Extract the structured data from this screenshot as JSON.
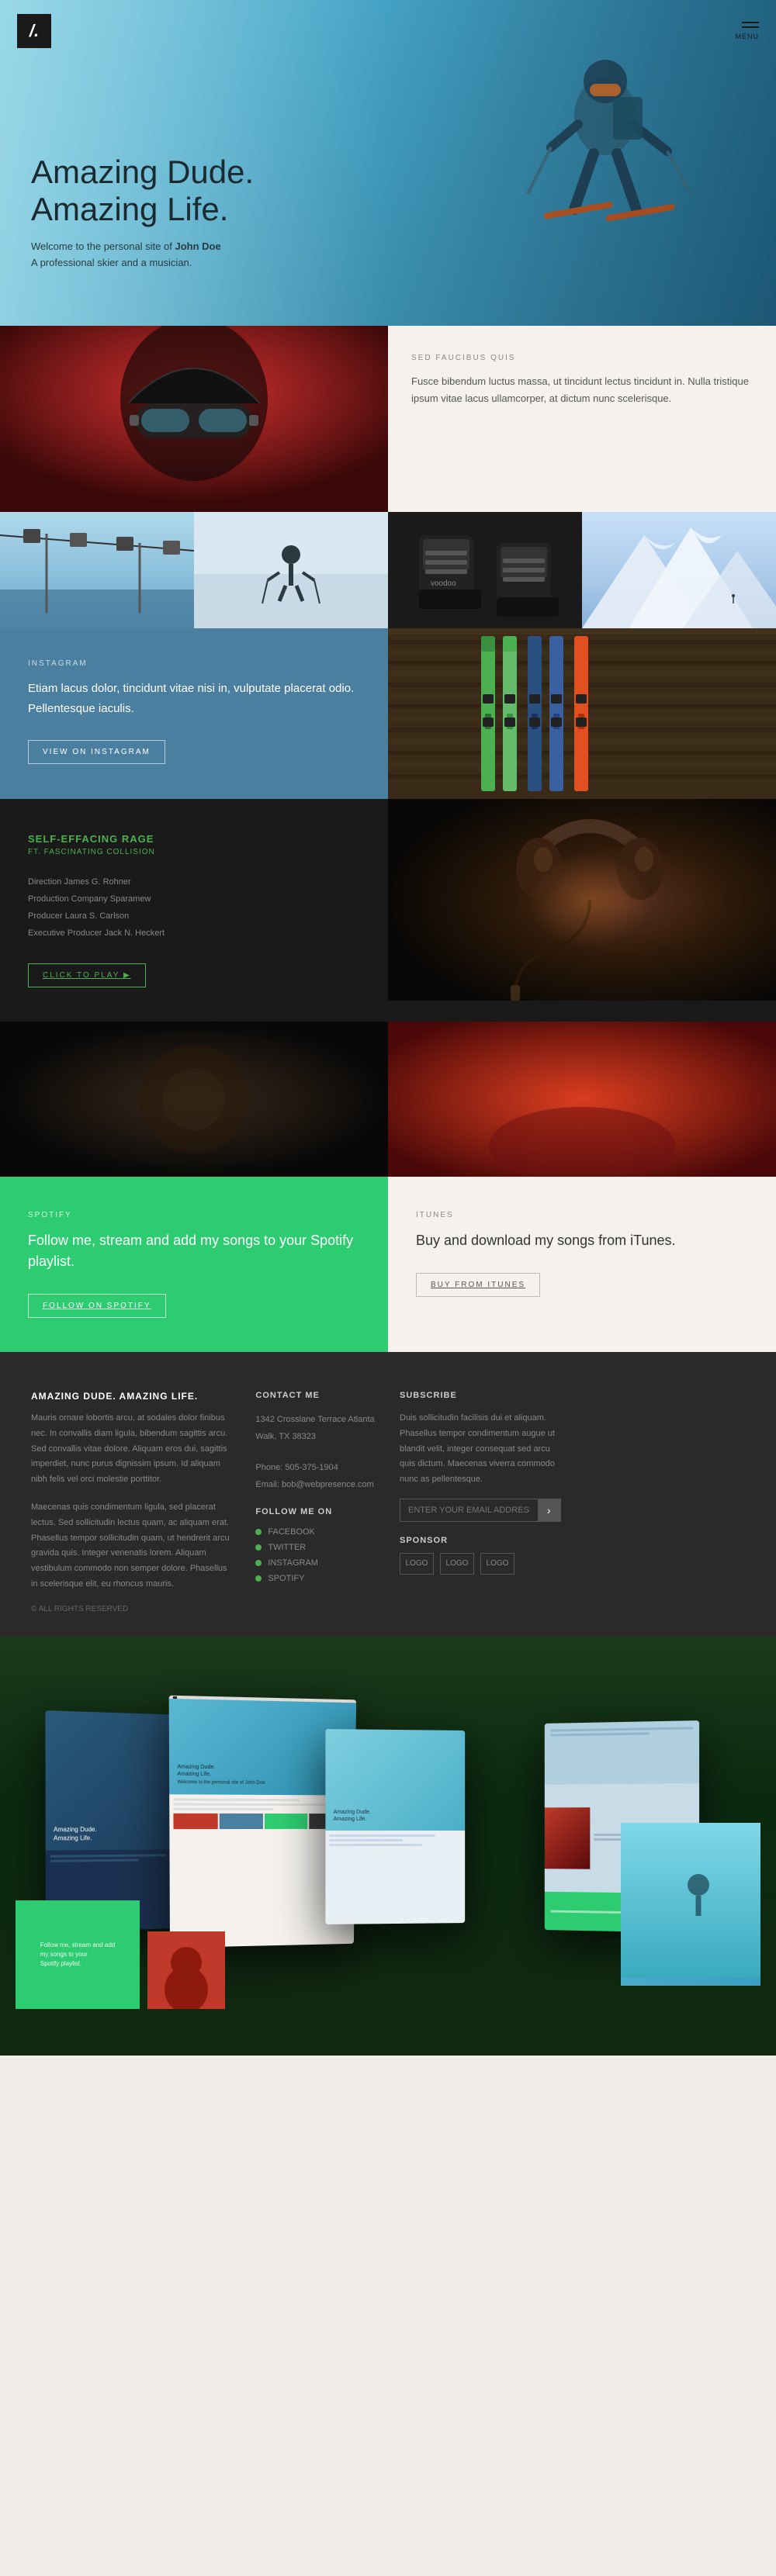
{
  "logo": {
    "symbol": "/.",
    "menu_label": "MENU"
  },
  "hero": {
    "title_line1": "Amazing Dude.",
    "title_line2": "Amazing Life.",
    "sub_intro": "Welcome to the personal site of ",
    "sub_name": "John Doe",
    "sub_role": "A professional skier and a musician."
  },
  "section_about": {
    "label": "SED FAUCIBUS QUIS",
    "body": "Fusce bibendum luctus massa, ut tincidunt lectus tincidunt in. Nulla tristique ipsum vitae lacus ullamcorper, at dictum nunc scelerisque."
  },
  "photo_grid": {
    "cells": [
      "ski-lift",
      "lone-skier",
      "ski-boots",
      "mountain-snow"
    ]
  },
  "instagram": {
    "label": "INSTAGRAM",
    "text": "Etiam lacus dolor, tincidunt vitae nisi in, vulputate placerat odio. Pellentesque iaculis.",
    "button_label": "VIEW ON INSTAGRAM"
  },
  "video": {
    "title": "SELF-EFFACING RAGE",
    "subtitle": "FT. FASCINATING COLLISION",
    "credit1_role": "Direction",
    "credit1_name": "James G. Rohner",
    "credit2_role": "Production Company",
    "credit2_name": "Sparamew",
    "credit3_role": "Producer",
    "credit3_name": "Laura S. Carlson",
    "credit4_role": "Executive Producer",
    "credit4_name": "Jack N. Heckert",
    "button_label": "CLICK TO PLAY ▶"
  },
  "spotify": {
    "label": "SPOTIFY",
    "text": "Follow me, stream and add my songs to your Spotify playlist.",
    "button_label": "FOLLOW ON SPOTIFY"
  },
  "itunes": {
    "label": "ITUNES",
    "text": "Buy and download my songs from iTunes.",
    "button_label": "BUY FROM ITUNES"
  },
  "footer": {
    "brand_title": "AMAZING DUDE. AMAZING LIFE.",
    "brand_text": "Mauris ornare lobortis arcu, at sodales dolor finibus nec. In convallis diam ligula, bibendum sagittis arcu. Sed convallis vitae dolore. Aliquam eros dui, sagittis imperdiet, nunc purus dignissim ipsum. Id aliquam nibh felis vel orci molestie porttitor.",
    "brand_text2": "Maecenas quis condimentum ligula, sed placerat lectus. Sed sollicitudin lectus quam, ac aliquam erat. Phasellus tempor sollicitudin quam, ut hendrerit arcu gravida quis. Integer venenatis lorem. Aliquam vestibulum commodo non semper dolore. Phasellus in scelerisque elit, eu rhoncus mauris.",
    "copyright": "© ALL RIGHTS RESERVED",
    "contact_title": "CONTACT ME",
    "contact_address": "1342 Crosslane Terrace Atlanta Walk, TX 38323",
    "contact_phone_label": "Phone",
    "contact_phone": "505-375-1904",
    "contact_email_label": "Email",
    "contact_email": "bob@webpresence.com",
    "follow_title": "FOLLOW ME ON",
    "social_items": [
      {
        "icon": "◆",
        "label": "FACEBOOK"
      },
      {
        "icon": "◆",
        "label": "TWITTER"
      },
      {
        "icon": "◆",
        "label": "INSTAGRAM"
      },
      {
        "icon": "◆",
        "label": "SPOTIFY"
      }
    ],
    "subscribe_title": "SUBSCRIBE",
    "subscribe_text": "Duis sollicitudin facilisis dui et aliquam. Phasellus tempor condimentum augue ut blandit velit, integer consequat sed arcu quis dictum. Maecenas viverra commodo nunc as pellentesque.",
    "email_placeholder": "ENTER YOUR EMAIL ADDRESS",
    "sponsor_title": "SPONSOR",
    "sponsor_logos": [
      "LOGO",
      "LOGO",
      "LOGO"
    ]
  },
  "mockup": {
    "title_line1": "Amazing Dude.",
    "title_line2": "Amazing Life.",
    "sub": "Welcome to the personal site of"
  }
}
